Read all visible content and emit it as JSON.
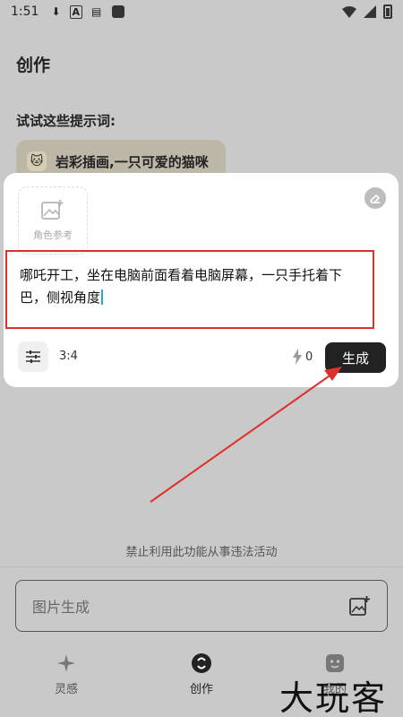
{
  "status_bar": {
    "time": "1:51"
  },
  "header": {
    "title": "创作"
  },
  "suggestions": {
    "title": "试试这些提示词:",
    "chip": {
      "emoji": "🐱",
      "text": "岩彩插画,一只可爱的猫咪"
    }
  },
  "composer": {
    "reference_label": "角色参考",
    "prompt_text": "哪吒开工，坐在电脑前面看着电脑屏幕，一只手托着下巴，侧视角度",
    "aspect_ratio": "3:4",
    "credits": "0",
    "generate_label": "生成"
  },
  "notice": "禁止利用此功能从事违法活动",
  "image_input": {
    "placeholder": "图片生成"
  },
  "tabs": [
    {
      "label": "灵感"
    },
    {
      "label": "创作"
    },
    {
      "label": "我的"
    }
  ],
  "watermark": "大玩客",
  "colors": {
    "highlight_red": "#e0302c",
    "primary_dark": "#222222",
    "cursor": "#1bb0c9"
  }
}
